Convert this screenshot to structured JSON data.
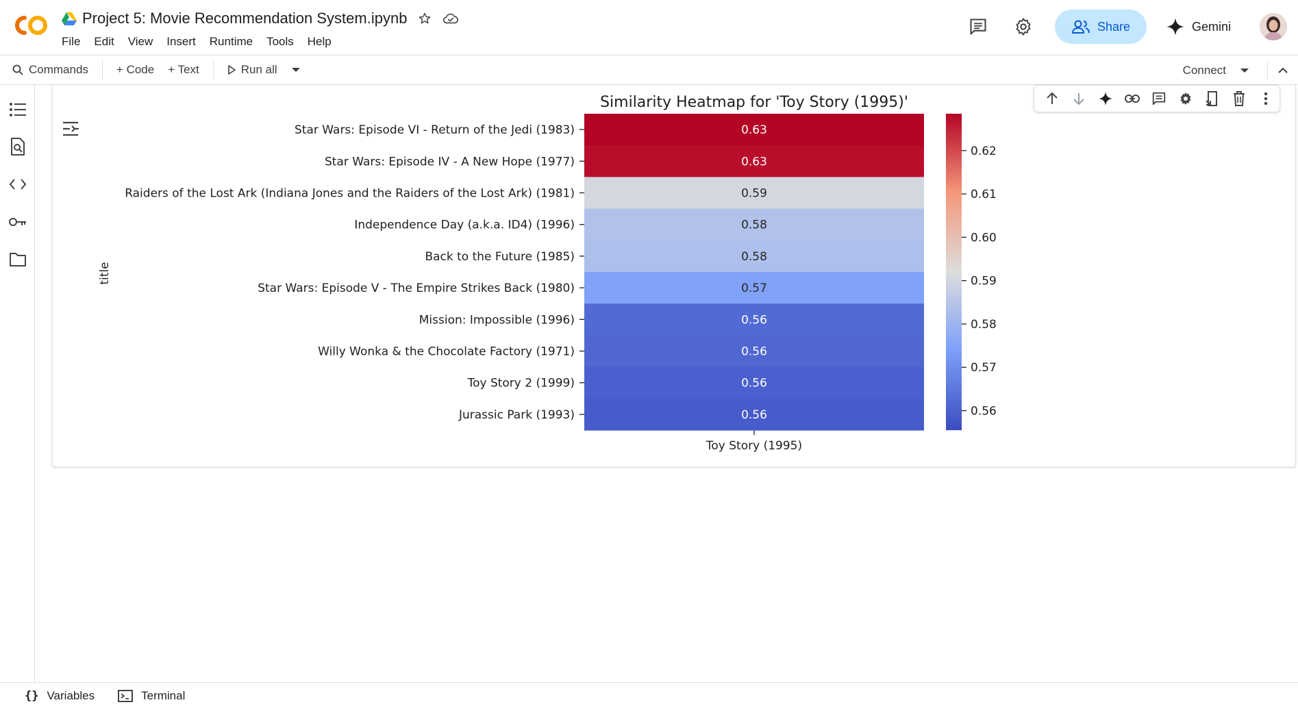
{
  "header": {
    "title": "Project 5: Movie Recommendation System.ipynb",
    "menu": [
      "File",
      "Edit",
      "View",
      "Insert",
      "Runtime",
      "Tools",
      "Help"
    ],
    "share_label": "Share",
    "gemini_label": "Gemini"
  },
  "toolbar": {
    "commands_label": "Commands",
    "code_label": "+ Code",
    "text_label": "+ Text",
    "run_all_label": "Run all",
    "connect_label": "Connect"
  },
  "bottombar": {
    "variables_label": "Variables",
    "terminal_label": "Terminal"
  },
  "colors": {
    "accent": "#0b57d0",
    "share_bg": "#c2e7ff",
    "logo_orange": "#f9ab00",
    "logo_dark_orange": "#e8710a"
  },
  "chart_data": {
    "type": "heatmap",
    "title": "Similarity Heatmap for 'Toy Story (1995)'",
    "ylabel": "title",
    "columns": [
      "Toy Story (1995)"
    ],
    "rows": [
      "Star Wars: Episode VI - Return of the Jedi (1983)",
      "Star Wars: Episode IV - A New Hope (1977)",
      "Raiders of the Lost Ark (Indiana Jones and the Raiders of the Lost Ark) (1981)",
      "Independence Day (a.k.a. ID4) (1996)",
      "Back to the Future (1985)",
      "Star Wars: Episode V - The Empire Strikes Back (1980)",
      "Mission: Impossible (1996)",
      "Willy Wonka & the Chocolate Factory (1971)",
      "Toy Story 2 (1999)",
      "Jurassic Park (1993)"
    ],
    "values": [
      0.6295,
      0.6273,
      0.5902,
      0.5837,
      0.5831,
      0.5745,
      0.562,
      0.5614,
      0.56,
      0.559
    ],
    "labels": [
      "0.63",
      "0.63",
      "0.59",
      "0.58",
      "0.58",
      "0.57",
      "0.56",
      "0.56",
      "0.56",
      "0.56"
    ],
    "colormap": "coolwarm",
    "colorbar_range": [
      0.5555,
      0.6285
    ],
    "colorbar_ticks": [
      "0.56",
      "0.57",
      "0.58",
      "0.59",
      "0.60",
      "0.61",
      "0.62"
    ]
  }
}
